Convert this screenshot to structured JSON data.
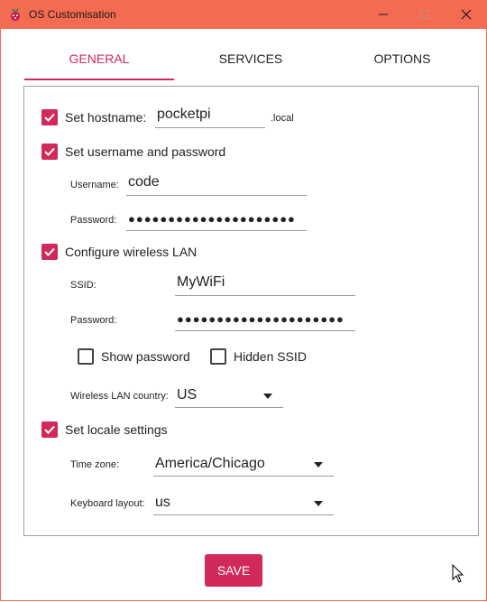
{
  "window": {
    "title": "OS Customisation",
    "minimize_glyph": "—",
    "maximize_glyph": "☐",
    "close_glyph": "✕"
  },
  "tabs": [
    {
      "label": "GENERAL",
      "active": true
    },
    {
      "label": "SERVICES",
      "active": false
    },
    {
      "label": "OPTIONS",
      "active": false
    }
  ],
  "general": {
    "hostname": {
      "label": "Set hostname:",
      "checked": true,
      "value": "pocketpi",
      "suffix": ".local"
    },
    "user": {
      "label": "Set username and password",
      "checked": true,
      "username_label": "Username:",
      "username_value": "code",
      "password_label": "Password:",
      "password_value": "●●●●●●●●●●●●●●●●●●●●●"
    },
    "wlan": {
      "label": "Configure wireless LAN",
      "checked": true,
      "ssid_label": "SSID:",
      "ssid_value": "MyWiFi",
      "password_label": "Password:",
      "password_value": "●●●●●●●●●●●●●●●●●●●●●",
      "show_password_label": "Show password",
      "show_password_checked": false,
      "hidden_ssid_label": "Hidden SSID",
      "hidden_ssid_checked": false,
      "country_label": "Wireless LAN country:",
      "country_value": "US"
    },
    "locale": {
      "label": "Set locale settings",
      "checked": true,
      "timezone_label": "Time zone:",
      "timezone_value": "America/Chicago",
      "keyboard_label": "Keyboard layout:",
      "keyboard_value": "us"
    }
  },
  "save_label": "SAVE",
  "colors": {
    "accent": "#d0295a",
    "titlebar": "#f36b50"
  }
}
